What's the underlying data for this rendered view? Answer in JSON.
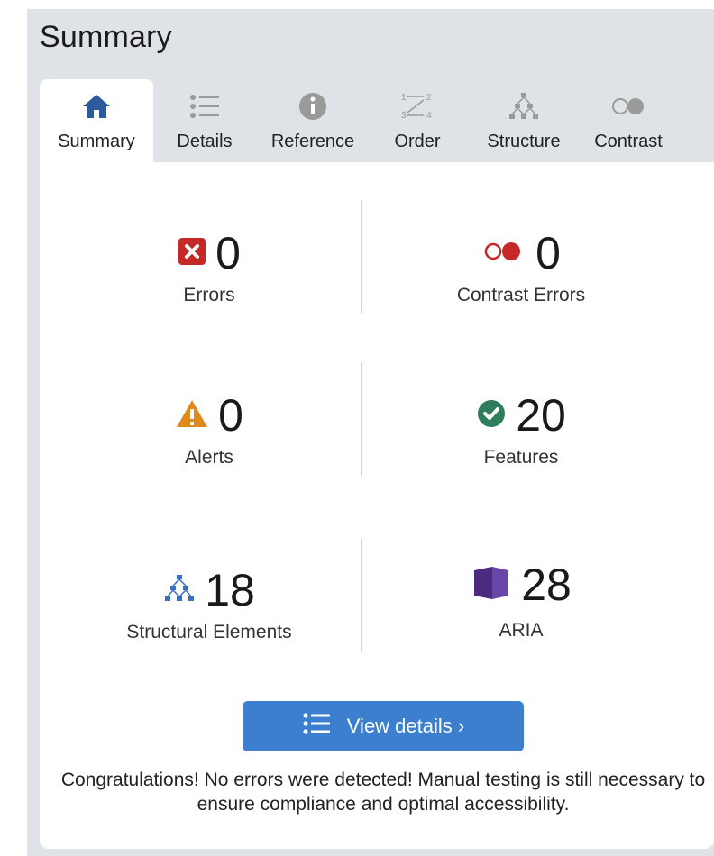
{
  "panel": {
    "title": "Summary"
  },
  "tabs": [
    {
      "label": "Summary",
      "icon": "home-icon",
      "active": true
    },
    {
      "label": "Details",
      "icon": "list-icon"
    },
    {
      "label": "Reference",
      "icon": "info-icon"
    },
    {
      "label": "Order",
      "icon": "order-icon"
    },
    {
      "label": "Structure",
      "icon": "structure-icon"
    },
    {
      "label": "Contrast",
      "icon": "contrast-icon"
    }
  ],
  "stats": {
    "errors": {
      "value": "0",
      "label": "Errors",
      "icon": "error-icon",
      "color": "#c62828"
    },
    "contrast_errors": {
      "value": "0",
      "label": "Contrast Errors",
      "icon": "contrast-error-icon",
      "color": "#c62828"
    },
    "alerts": {
      "value": "0",
      "label": "Alerts",
      "icon": "alert-icon",
      "color": "#e08a1e"
    },
    "features": {
      "value": "20",
      "label": "Features",
      "icon": "check-icon",
      "color": "#2e7d5b"
    },
    "structural": {
      "value": "18",
      "label": "Structural Elements",
      "icon": "structure-icon",
      "color": "#3a6fc4"
    },
    "aria": {
      "value": "28",
      "label": "ARIA",
      "icon": "aria-icon",
      "color": "#4b2a7f"
    }
  },
  "actions": {
    "view_details": "View details ›"
  },
  "message": "Congratulations! No errors were detected! Manual testing is still necessary to ensure compliance and optimal accessibility.",
  "colors": {
    "accent": "#3c7fcf",
    "background": "#dfe3e8"
  }
}
